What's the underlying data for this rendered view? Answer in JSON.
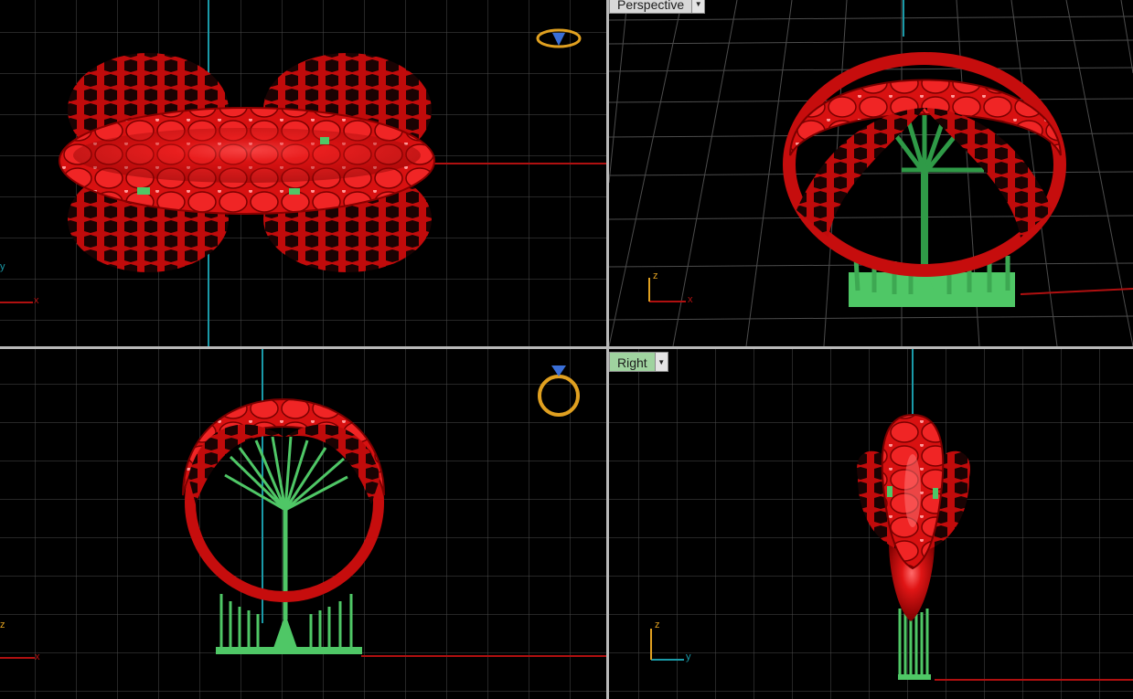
{
  "viewports": {
    "top": {
      "label": ""
    },
    "perspective": {
      "label": "Perspective"
    },
    "front": {
      "label": ""
    },
    "right": {
      "label": "Right"
    }
  },
  "axes": {
    "top": {
      "a1": "y",
      "a2": "x"
    },
    "perspective": {
      "a1": "z",
      "a2": "x"
    },
    "front": {
      "a1": "z",
      "a2": "x"
    },
    "right": {
      "a1": "z",
      "a2": "y"
    }
  },
  "colors": {
    "ring": "#d40d0d",
    "support": "#4fc766",
    "grid": "#4c4c4c",
    "axis_x": "#b01010",
    "axis_y": "#1a9aa8",
    "gumball": "#e0a020"
  },
  "icons": {
    "view_cube_top": "ring-view-icon",
    "view_cube_front": "ring-view-icon"
  }
}
